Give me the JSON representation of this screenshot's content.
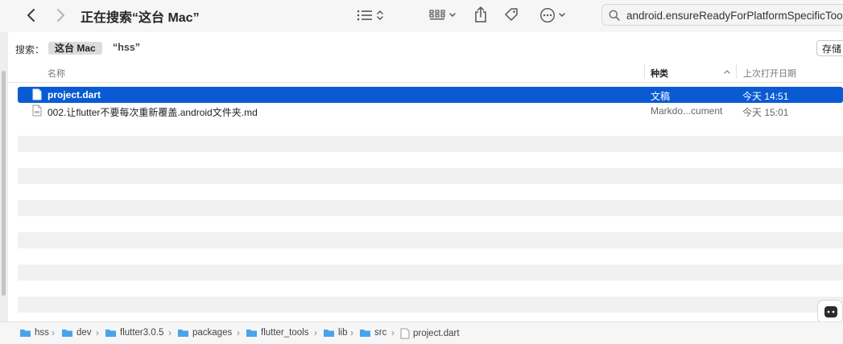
{
  "window": {
    "title": "正在搜索“这台 Mac”"
  },
  "search": {
    "value": "android.ensureReadyForPlatformSpecificTooling"
  },
  "scope": {
    "label": "搜索：",
    "this_mac": "这台 Mac",
    "folder": "“hss”",
    "save_label": "存储"
  },
  "columns": {
    "name": "名称",
    "kind": "种类",
    "date": "上次打开日期"
  },
  "files": [
    {
      "name": "project.dart",
      "kind": "文稿",
      "date": "今天 14:51",
      "selected": true
    },
    {
      "name": "002.让flutter不要每次重新覆盖.android文件夹.md",
      "kind": "Markdo...cument",
      "date": "今天 15:01",
      "selected": false
    }
  ],
  "path": [
    "hss",
    "dev",
    "flutter3.0.5",
    "packages",
    "flutter_tools",
    "lib",
    "src",
    "project.dart"
  ],
  "colors": {
    "selection": "#0a5bd3",
    "folder": "#4aa3e8"
  },
  "icons": [
    "back-icon",
    "forward-icon",
    "list-view-icon",
    "sort-icon",
    "grid-view-icon",
    "chevron-down-icon",
    "share-icon",
    "tag-icon",
    "more-icon",
    "search-icon",
    "document-icon",
    "folder-icon",
    "chevron-right-icon",
    "sort-arrow-icon"
  ]
}
